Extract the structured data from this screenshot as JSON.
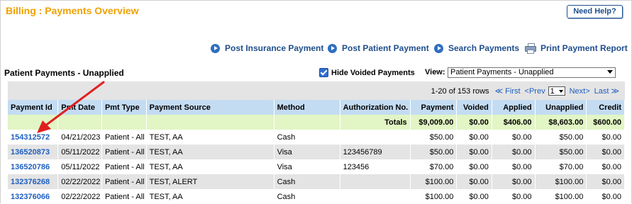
{
  "header": {
    "title": "Billing : Payments Overview",
    "help_label": "Need Help?"
  },
  "actions": [
    {
      "label": "Post Insurance Payment",
      "icon": "arrow-circle-icon"
    },
    {
      "label": "Post Patient Payment",
      "icon": "arrow-circle-icon"
    },
    {
      "label": "Search Payments",
      "icon": "arrow-circle-icon"
    },
    {
      "label": "Print Payment Report",
      "icon": "printer-icon"
    }
  ],
  "section": {
    "title": "Patient Payments - Unapplied",
    "hide_voided_label": "Hide Voided Payments",
    "hide_voided_checked": true,
    "view_label": "View:",
    "view_value": "Patient Payments - Unapplied"
  },
  "pager": {
    "range": "1-20 of 153 rows",
    "first": "≪ First",
    "prev": "<Prev",
    "page": "1",
    "next": "Next>",
    "last": "Last ≫"
  },
  "table": {
    "columns": [
      "Payment Id",
      "Pmt Date",
      "Pmt Type",
      "Payment Source",
      "Method",
      "Authorization No.",
      "Payment",
      "Voided",
      "Applied",
      "Unapplied",
      "Credit"
    ],
    "totals": {
      "label": "Totals",
      "payment": "$9,009.00",
      "voided": "$0.00",
      "applied": "$406.00",
      "unapplied": "$8,603.00",
      "credit": "$600.00"
    },
    "rows": [
      {
        "id": "154312572",
        "date": "04/21/2023",
        "type": "Patient - All",
        "source": "TEST, AA",
        "method": "Cash",
        "auth": "",
        "payment": "$50.00",
        "voided": "$0.00",
        "applied": "$0.00",
        "unapplied": "$50.00",
        "credit": "$0.00"
      },
      {
        "id": "136520873",
        "date": "05/11/2022",
        "type": "Patient - All",
        "source": "TEST, AA",
        "method": "Visa",
        "auth": "123456789",
        "payment": "$50.00",
        "voided": "$0.00",
        "applied": "$0.00",
        "unapplied": "$50.00",
        "credit": "$0.00"
      },
      {
        "id": "136520786",
        "date": "05/11/2022",
        "type": "Patient - All",
        "source": "TEST, AA",
        "method": "Visa",
        "auth": "123456",
        "payment": "$70.00",
        "voided": "$0.00",
        "applied": "$0.00",
        "unapplied": "$70.00",
        "credit": "$0.00"
      },
      {
        "id": "132376268",
        "date": "02/22/2022",
        "type": "Patient - All",
        "source": "TEST, ALERT",
        "method": "Cash",
        "auth": "",
        "payment": "$100.00",
        "voided": "$0.00",
        "applied": "$0.00",
        "unapplied": "$100.00",
        "credit": "$0.00"
      },
      {
        "id": "132376066",
        "date": "02/22/2022",
        "type": "Patient - All",
        "source": "TEST, AA",
        "method": "Cash",
        "auth": "",
        "payment": "$100.00",
        "voided": "$0.00",
        "applied": "$0.00",
        "unapplied": "$100.00",
        "credit": "$0.00"
      }
    ]
  },
  "colors": {
    "title": "#f0a000",
    "link": "#1f5fbf",
    "header_bg": "#c4dcf2",
    "totals_bg": "#e2f5c4",
    "annotation_arrow": "#e02020"
  }
}
